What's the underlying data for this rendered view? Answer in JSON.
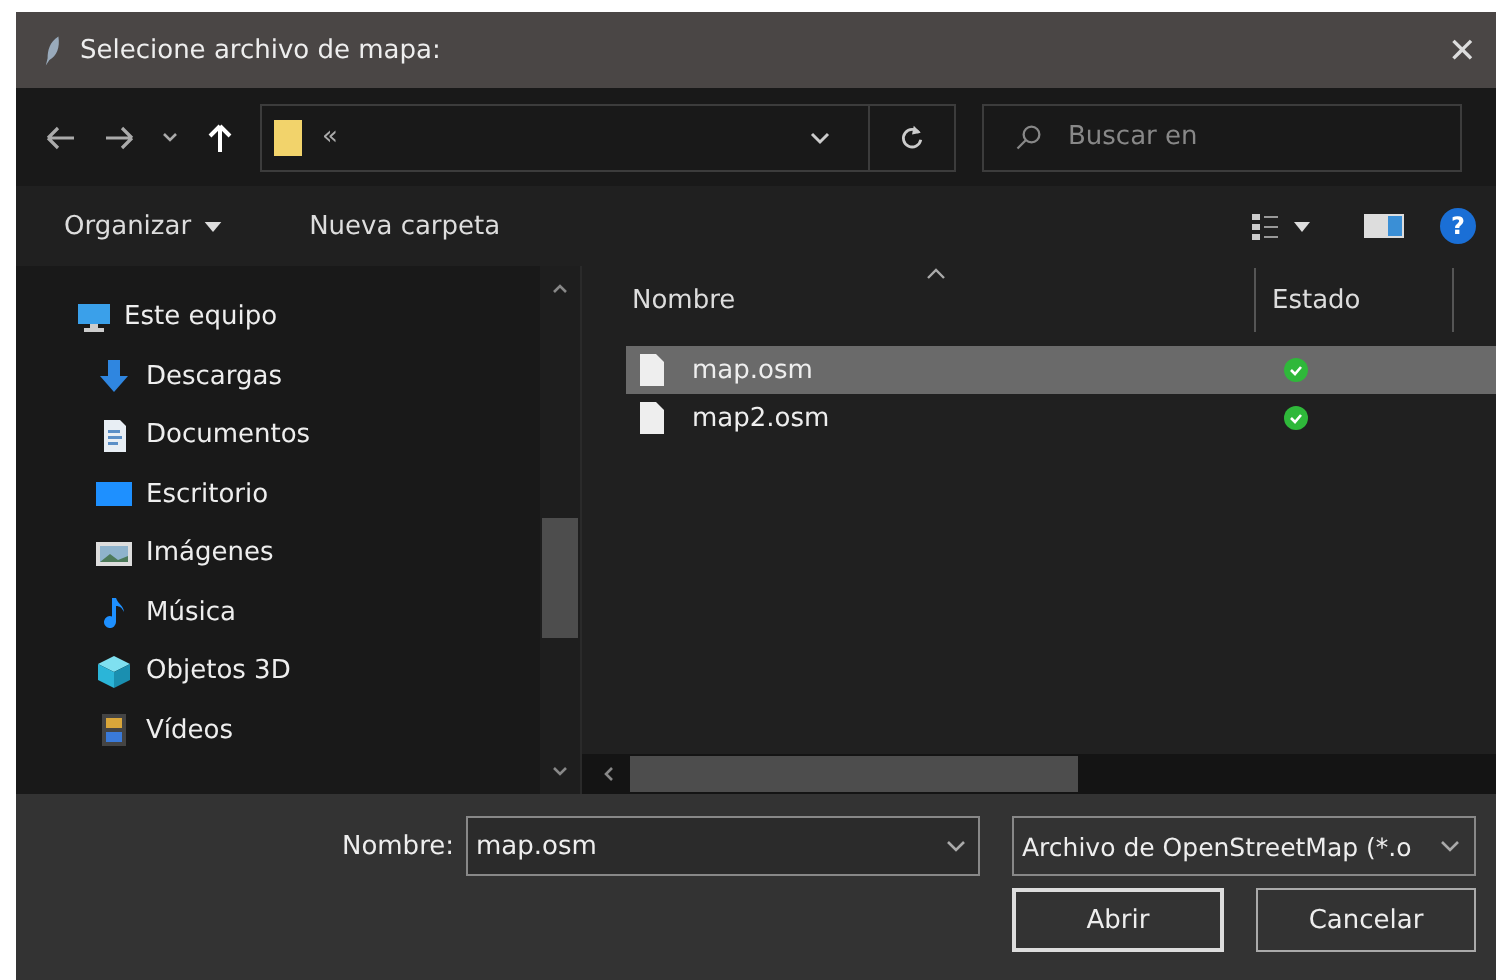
{
  "window": {
    "title": "Selecione archivo de mapa:",
    "close": "✕"
  },
  "address": {
    "path": "«"
  },
  "search": {
    "placeholder": "Buscar en"
  },
  "toolbar": {
    "organize": "Organizar",
    "new_folder": "Nueva carpeta",
    "help": "?"
  },
  "sidebar": {
    "items": [
      {
        "label": "Este equipo",
        "kind": "computer",
        "children": [
          {
            "label": "Descargas",
            "kind": "downloads"
          },
          {
            "label": "Documentos",
            "kind": "documents"
          },
          {
            "label": "Escritorio",
            "kind": "desktop"
          },
          {
            "label": "Imágenes",
            "kind": "pictures"
          },
          {
            "label": "Música",
            "kind": "music"
          },
          {
            "label": "Objetos 3D",
            "kind": "objects3d"
          },
          {
            "label": "Vídeos",
            "kind": "videos"
          }
        ]
      }
    ]
  },
  "table": {
    "columns": [
      "Nombre",
      "Estado"
    ],
    "rows": [
      {
        "name": "map.osm",
        "kind": "synced",
        "selected": true
      },
      {
        "name": "map2.osm",
        "kind": "synced",
        "selected": false
      }
    ]
  },
  "footer": {
    "name_label": "Nombre:",
    "name_value": "map.osm",
    "filetype": "Archivo de OpenStreetMap (*.o",
    "buttons": [
      {
        "label": "Abrir",
        "default": true
      },
      {
        "label": "Cancelar",
        "default": false
      }
    ]
  }
}
